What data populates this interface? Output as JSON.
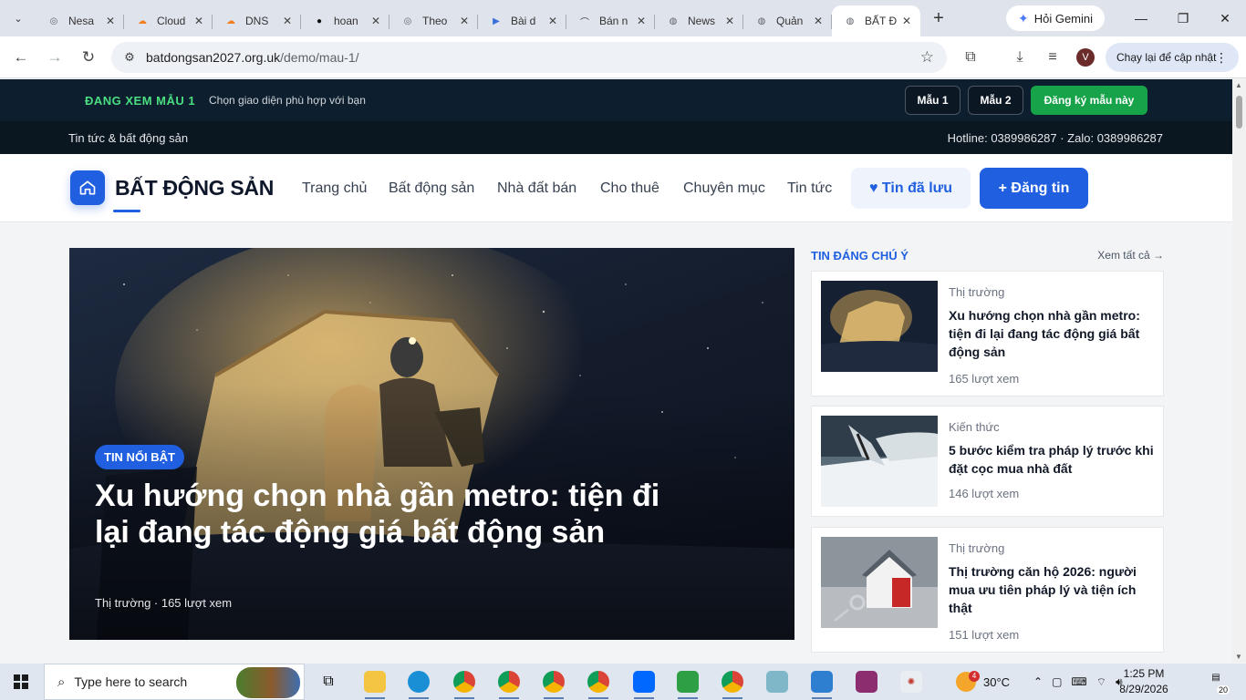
{
  "browser": {
    "tabs": [
      {
        "title": "Nesa",
        "color": "#5f6368",
        "glyph": "◎"
      },
      {
        "title": "Cloud",
        "color": "#f38020",
        "glyph": "☁"
      },
      {
        "title": "DNS",
        "color": "#f38020",
        "glyph": "☁"
      },
      {
        "title": "hoan",
        "color": "#111111",
        "glyph": "●"
      },
      {
        "title": "Theo",
        "color": "#5f6368",
        "glyph": "◎"
      },
      {
        "title": "Bài d",
        "color": "#3b6fd8",
        "glyph": "▶"
      },
      {
        "title": "Bán n",
        "color": "#444444",
        "glyph": "⌒"
      },
      {
        "title": "News",
        "color": "#5f6368",
        "glyph": "◍"
      },
      {
        "title": "Quản",
        "color": "#5f6368",
        "glyph": "◍"
      },
      {
        "title": "BẤT Đ",
        "color": "#5f6368",
        "glyph": "◍"
      }
    ],
    "active_tab_index": 9,
    "gemini_label": "Hỏi Gemini",
    "url_host": "batdongsan2027.org.uk",
    "url_path": "/demo/mau-1/",
    "profile_initial": "V",
    "update_label": "Chạy lại để cập nhật"
  },
  "page": {
    "demo": {
      "label": "ĐANG XEM MẪU 1",
      "subtitle": "Chọn giao diện phù hợp với bạn",
      "btn_mau1": "Mẫu 1",
      "btn_mau2": "Mẫu 2",
      "btn_register": "Đăng ký mẫu này"
    },
    "topbar": {
      "left": "Tin tức & bất động sản",
      "right": "Hotline: 0389986287 · Zalo: 0389986287"
    },
    "header": {
      "logo_text": "BẤT ĐỘNG SẢN",
      "nav": [
        "Trang chủ",
        "Bất động sản",
        "Nhà đất bán",
        "Cho thuê",
        "Chuyên mục",
        "Tin tức"
      ],
      "saved_label": "♥ Tin đã lưu",
      "post_label": "+ Đăng tin"
    },
    "hero": {
      "badge": "TIN NỔI BẬT",
      "title": "Xu hướng chọn nhà gần metro: tiện đi lại đang tác động giá bất động sản",
      "meta": "Thị trường · 165 lượt xem"
    },
    "sidebar": {
      "title": "TIN ĐÁNG CHÚ Ý",
      "see_all": "Xem tất cả →",
      "items": [
        {
          "category": "Thị trường",
          "title": "Xu hướng chọn nhà gần metro: tiện đi lại đang tác động giá bất động sản",
          "views": "165 lượt xem"
        },
        {
          "category": "Kiến thức",
          "title": "5 bước kiểm tra pháp lý trước khi đặt cọc mua nhà đất",
          "views": "146 lượt xem"
        },
        {
          "category": "Thị trường",
          "title": "Thị trường căn hộ 2026: người mua ưu tiên pháp lý và tiện ích thật",
          "views": "151 lượt xem"
        }
      ]
    }
  },
  "taskbar": {
    "search_placeholder": "Type here to search",
    "weather": "30°C",
    "weather_badge": "4",
    "time": "1:25 PM",
    "date": "8/29/2026",
    "notifications": "20"
  }
}
